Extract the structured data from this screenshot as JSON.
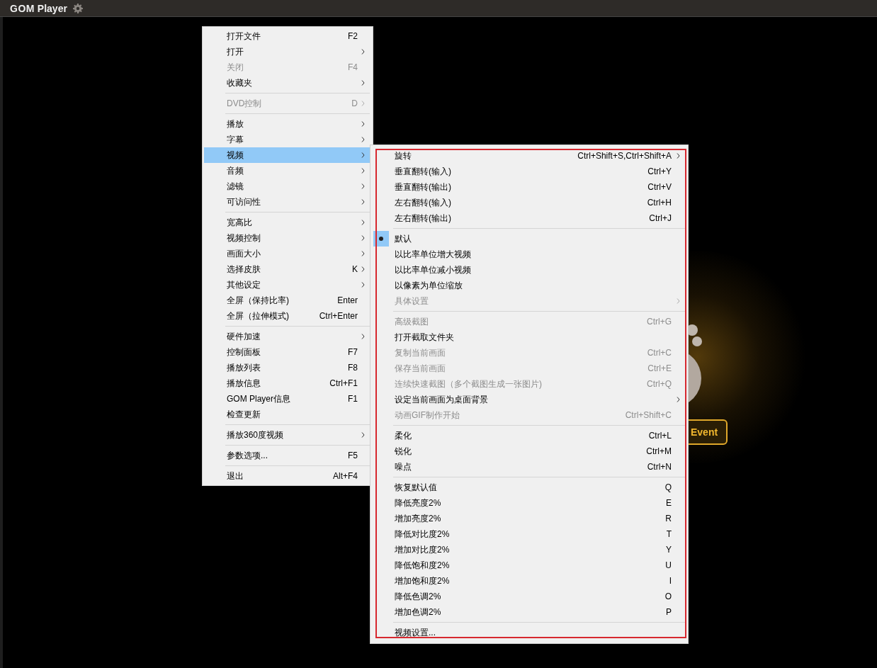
{
  "title_bar": {
    "brand": "GOM",
    "name": "Player"
  },
  "background_button": {
    "label": "Event"
  },
  "main_menu": [
    {
      "kind": "item",
      "label": "打开文件",
      "shortcut": "F2",
      "submenu": false,
      "disabled": false,
      "selected": false
    },
    {
      "kind": "item",
      "label": "打开",
      "submenu": true,
      "disabled": false,
      "selected": false
    },
    {
      "kind": "item",
      "label": "关闭",
      "shortcut": "F4",
      "submenu": false,
      "disabled": true,
      "selected": false
    },
    {
      "kind": "item",
      "label": "收藏夹",
      "submenu": true,
      "disabled": false,
      "selected": false
    },
    {
      "kind": "separator"
    },
    {
      "kind": "item",
      "label": "DVD控制",
      "shortcut": "D",
      "submenu": true,
      "disabled": true,
      "selected": false
    },
    {
      "kind": "separator"
    },
    {
      "kind": "item",
      "label": "播放",
      "submenu": true,
      "disabled": false,
      "selected": false
    },
    {
      "kind": "item",
      "label": "字幕",
      "submenu": true,
      "disabled": false,
      "selected": false
    },
    {
      "kind": "item",
      "label": "视频",
      "submenu": true,
      "disabled": false,
      "selected": true
    },
    {
      "kind": "item",
      "label": "音频",
      "submenu": true,
      "disabled": false,
      "selected": false
    },
    {
      "kind": "item",
      "label": "滤镜",
      "submenu": true,
      "disabled": false,
      "selected": false
    },
    {
      "kind": "item",
      "label": "可访问性",
      "submenu": true,
      "disabled": false,
      "selected": false
    },
    {
      "kind": "separator"
    },
    {
      "kind": "item",
      "label": "宽高比",
      "submenu": true,
      "disabled": false,
      "selected": false
    },
    {
      "kind": "item",
      "label": "视频控制",
      "submenu": true,
      "disabled": false,
      "selected": false
    },
    {
      "kind": "item",
      "label": "画面大小",
      "submenu": true,
      "disabled": false,
      "selected": false
    },
    {
      "kind": "item",
      "label": "选择皮肤",
      "shortcut": "K",
      "submenu": true,
      "disabled": false,
      "selected": false
    },
    {
      "kind": "item",
      "label": "其他设定",
      "submenu": true,
      "disabled": false,
      "selected": false
    },
    {
      "kind": "item",
      "label": "全屏（保持比率)",
      "shortcut": "Enter",
      "submenu": false,
      "disabled": false,
      "selected": false
    },
    {
      "kind": "item",
      "label": "全屏（拉伸模式)",
      "shortcut": "Ctrl+Enter",
      "submenu": false,
      "disabled": false,
      "selected": false
    },
    {
      "kind": "separator"
    },
    {
      "kind": "item",
      "label": "硬件加速",
      "submenu": true,
      "disabled": false,
      "selected": false
    },
    {
      "kind": "item",
      "label": "控制面板",
      "shortcut": "F7",
      "submenu": false,
      "disabled": false,
      "selected": false
    },
    {
      "kind": "item",
      "label": "播放列表",
      "shortcut": "F8",
      "submenu": false,
      "disabled": false,
      "selected": false
    },
    {
      "kind": "item",
      "label": "播放信息",
      "shortcut": "Ctrl+F1",
      "submenu": false,
      "disabled": false,
      "selected": false
    },
    {
      "kind": "item",
      "label": "GOM Player信息",
      "shortcut": "F1",
      "submenu": false,
      "disabled": false,
      "selected": false
    },
    {
      "kind": "item",
      "label": "检查更新",
      "submenu": false,
      "disabled": false,
      "selected": false
    },
    {
      "kind": "separator"
    },
    {
      "kind": "item",
      "label": "播放360度视频",
      "submenu": true,
      "disabled": false,
      "selected": false
    },
    {
      "kind": "separator"
    },
    {
      "kind": "item",
      "label": "参数选项...",
      "shortcut": "F5",
      "submenu": false,
      "disabled": false,
      "selected": false
    },
    {
      "kind": "separator"
    },
    {
      "kind": "item",
      "label": "退出",
      "shortcut": "Alt+F4",
      "submenu": false,
      "disabled": false,
      "selected": false
    }
  ],
  "video_submenu": [
    {
      "kind": "item",
      "label": "旋转",
      "shortcut": "Ctrl+Shift+S,Ctrl+Shift+A",
      "submenu": true,
      "disabled": false,
      "checked": false
    },
    {
      "kind": "item",
      "label": "垂直翻转(输入)",
      "shortcut": "Ctrl+Y",
      "submenu": false,
      "disabled": false,
      "checked": false
    },
    {
      "kind": "item",
      "label": "垂直翻转(输出)",
      "shortcut": "Ctrl+V",
      "submenu": false,
      "disabled": false,
      "checked": false
    },
    {
      "kind": "item",
      "label": "左右翻转(输入)",
      "shortcut": "Ctrl+H",
      "submenu": false,
      "disabled": false,
      "checked": false
    },
    {
      "kind": "item",
      "label": "左右翻转(输出)",
      "shortcut": "Ctrl+J",
      "submenu": false,
      "disabled": false,
      "checked": false
    },
    {
      "kind": "separator"
    },
    {
      "kind": "item",
      "label": "默认",
      "submenu": false,
      "disabled": false,
      "checked": true
    },
    {
      "kind": "item",
      "label": "以比率单位增大视频",
      "submenu": false,
      "disabled": false,
      "checked": false
    },
    {
      "kind": "item",
      "label": "以比率单位减小视频",
      "submenu": false,
      "disabled": false,
      "checked": false
    },
    {
      "kind": "item",
      "label": "以像素为单位缩放",
      "submenu": false,
      "disabled": false,
      "checked": false
    },
    {
      "kind": "item",
      "label": "具体设置",
      "submenu": true,
      "disabled": true,
      "checked": false
    },
    {
      "kind": "separator"
    },
    {
      "kind": "item",
      "label": "高级截图",
      "shortcut": "Ctrl+G",
      "submenu": false,
      "disabled": true,
      "checked": false
    },
    {
      "kind": "item",
      "label": "打开截取文件夹",
      "submenu": false,
      "disabled": false,
      "checked": false
    },
    {
      "kind": "item",
      "label": "复制当前画面",
      "shortcut": "Ctrl+C",
      "submenu": false,
      "disabled": true,
      "checked": false
    },
    {
      "kind": "item",
      "label": "保存当前画面",
      "shortcut": "Ctrl+E",
      "submenu": false,
      "disabled": true,
      "checked": false
    },
    {
      "kind": "item",
      "label": "连续快速截图（多个截图生成一张图片)",
      "shortcut": "Ctrl+Q",
      "submenu": false,
      "disabled": true,
      "checked": false
    },
    {
      "kind": "item",
      "label": "设定当前画面为桌面背景",
      "submenu": true,
      "disabled": false,
      "checked": false
    },
    {
      "kind": "item",
      "label": "动画GIF制作开始",
      "shortcut": "Ctrl+Shift+C",
      "submenu": false,
      "disabled": true,
      "checked": false
    },
    {
      "kind": "separator"
    },
    {
      "kind": "item",
      "label": "柔化",
      "shortcut": "Ctrl+L",
      "submenu": false,
      "disabled": false,
      "checked": false
    },
    {
      "kind": "item",
      "label": "锐化",
      "shortcut": "Ctrl+M",
      "submenu": false,
      "disabled": false,
      "checked": false
    },
    {
      "kind": "item",
      "label": "噪点",
      "shortcut": "Ctrl+N",
      "submenu": false,
      "disabled": false,
      "checked": false
    },
    {
      "kind": "separator"
    },
    {
      "kind": "item",
      "label": "恢复默认值",
      "shortcut": "Q",
      "submenu": false,
      "disabled": false,
      "checked": false
    },
    {
      "kind": "item",
      "label": "降低亮度2%",
      "shortcut": "E",
      "submenu": false,
      "disabled": false,
      "checked": false
    },
    {
      "kind": "item",
      "label": "增加亮度2%",
      "shortcut": "R",
      "submenu": false,
      "disabled": false,
      "checked": false
    },
    {
      "kind": "item",
      "label": "降低对比度2%",
      "shortcut": "T",
      "submenu": false,
      "disabled": false,
      "checked": false
    },
    {
      "kind": "item",
      "label": "增加对比度2%",
      "shortcut": "Y",
      "submenu": false,
      "disabled": false,
      "checked": false
    },
    {
      "kind": "item",
      "label": "降低饱和度2%",
      "shortcut": "U",
      "submenu": false,
      "disabled": false,
      "checked": false
    },
    {
      "kind": "item",
      "label": "增加饱和度2%",
      "shortcut": "I",
      "submenu": false,
      "disabled": false,
      "checked": false
    },
    {
      "kind": "item",
      "label": "降低色调2%",
      "shortcut": "O",
      "submenu": false,
      "disabled": false,
      "checked": false
    },
    {
      "kind": "item",
      "label": "增加色调2%",
      "shortcut": "P",
      "submenu": false,
      "disabled": false,
      "checked": false
    },
    {
      "kind": "separator"
    },
    {
      "kind": "item",
      "label": "视频设置...",
      "submenu": false,
      "disabled": false,
      "checked": false
    }
  ]
}
